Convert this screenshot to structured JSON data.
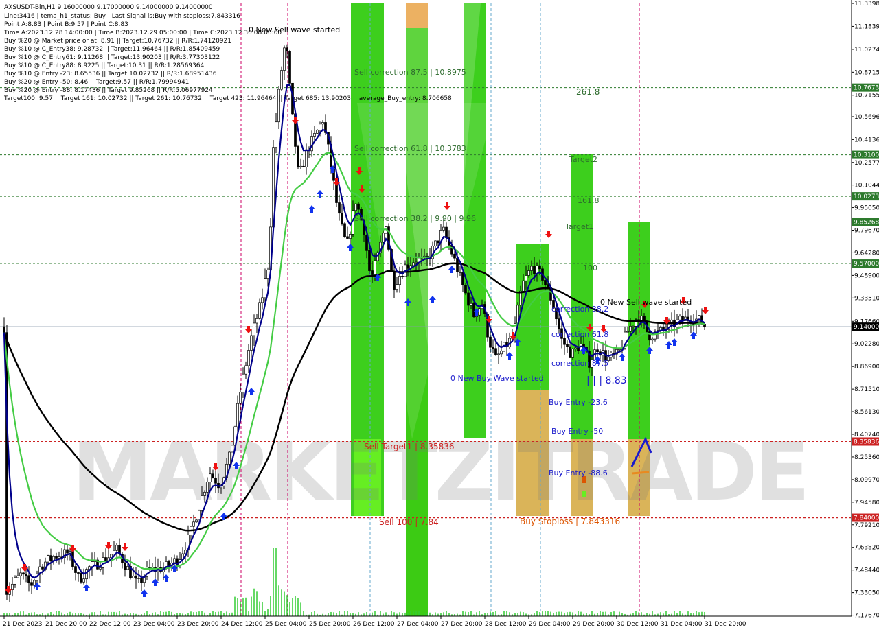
{
  "header": {
    "symbol_line": "AXSUSDT-Bin,H1  9.16000000 9.17000000 9.14000000 9.14000000",
    "info_lines": [
      "Line:3416 | tema_h1_status: Buy | Last Signal is:Buy with stoploss:7.843316",
      "Point A:8.83 | Point B:9.57 | Point C:8.83",
      "Time A:2023.12.28 14:00:00 | Time B:2023.12.29 05:00:00 | Time C:2023.12.30 08:00:00",
      "Buy %20 @ Market price or at: 8.91 || Target:10.76732 || R/R:1.74120921",
      "Buy %10 @ C_Entry38: 9.28732 || Target:11.96464 || R/R:1.85409459",
      "Buy %10 @ C_Entry61: 9.11268 || Target:13.90203 || R/R:3.77303122",
      "Buy %10 @ C_Entry88: 8.9225 || Target:10.31 || R/R:1.28569364",
      "Buy %10 @ Entry -23: 8.65536 || Target:10.02732 || R/R:1.68951436",
      "Buy %20 @ Entry -50: 8.46 || Target:9.57 || R/R:1.79994941",
      "Buy %20 @ Entry -88: 8.17436 || Target:9.85268 || R/R:5.06977924",
      "Target100: 9.57 || Target 161: 10.02732 || Target 261: 10.76732 || Target 423: 11.96464 || Target 685: 13.90203 || average_Buy_entry: 8.706658"
    ]
  },
  "watermark": "MARKETZITRADE",
  "colors": {
    "green_zone": "#33cc11",
    "green_zone_light": "#66ee22",
    "orange_zone": "#e8a040",
    "tan_zone": "#d8b050",
    "grid_green": "#2d7a2d",
    "grid_red": "#cc0000",
    "ema_fast": "#00008b",
    "ema_mid": "#44cc44",
    "ema_slow": "#000000",
    "label_green": "#2d6b2d",
    "label_blue": "#1a1acc",
    "label_red": "#cc2222",
    "label_orange": "#dd5500"
  },
  "chart_data": {
    "type": "candlestick",
    "symbol": "AXSUSDT-Bin",
    "timeframe": "H1",
    "last_price": 9.14,
    "ylim": [
      7.17,
      11.34
    ],
    "y_ticks": [
      "11.33980",
      "11.18390",
      "11.02740",
      "10.87150",
      "10.71550",
      "10.56960",
      "10.41360",
      "10.25770",
      "10.10440",
      "9.95050",
      "9.79670",
      "9.64280",
      "9.48900",
      "9.33510",
      "9.17660",
      "9.02280",
      "8.86900",
      "8.71510",
      "8.56130",
      "8.40740",
      "8.25360",
      "8.09970",
      "7.94580",
      "7.79210",
      "7.63820",
      "7.48440",
      "7.33050",
      "7.17670"
    ],
    "x_ticks": [
      "21 Dec 2023",
      "21 Dec 20:00",
      "22 Dec 12:00",
      "23 Dec 04:00",
      "23 Dec 20:00",
      "24 Dec 12:00",
      "25 Dec 04:00",
      "25 Dec 20:00",
      "26 Dec 12:00",
      "27 Dec 04:00",
      "27 Dec 20:00",
      "28 Dec 12:00",
      "29 Dec 04:00",
      "29 Dec 20:00",
      "30 Dec 12:00",
      "31 Dec 04:00",
      "31 Dec 20:00"
    ],
    "levels": [
      {
        "value": 10.7673,
        "label": "10.7673",
        "color": "#2d7a2d"
      },
      {
        "value": 10.31,
        "label": "10.3100",
        "color": "#2d7a2d"
      },
      {
        "value": 10.0273,
        "label": "10.0273",
        "color": "#2d7a2d"
      },
      {
        "value": 9.8527,
        "label": "9.85268",
        "color": "#2d7a2d"
      },
      {
        "value": 9.57,
        "label": "9.57000",
        "color": "#2d7a2d"
      },
      {
        "value": 8.3584,
        "label": "8.35836",
        "color": "#cc2222"
      },
      {
        "value": 7.84,
        "label": "7.84000",
        "color": "#cc2222"
      }
    ],
    "last_price_label": "9.14000",
    "annotations": [
      {
        "text": "0 New Sell wave started",
        "color": "#000000"
      },
      {
        "text": "Sell correction 87.5 | 10.8975",
        "color": "#2d6b2d"
      },
      {
        "text": "Sell correction 61.8 | 10.3783",
        "color": "#2d6b2d"
      },
      {
        "text": "Sell correction 38.2 | 9.90 | 9.96",
        "color": "#2d6b2d"
      },
      {
        "text": "261.8",
        "color": "#2d6b2d"
      },
      {
        "text": "Target2",
        "color": "#2d6b2d"
      },
      {
        "text": "161.8",
        "color": "#2d6b2d"
      },
      {
        "text": "Target1",
        "color": "#2d6b2d"
      },
      {
        "text": "100",
        "color": "#2d6b2d"
      },
      {
        "text": "0 New Sell wave started",
        "color": "#000000"
      },
      {
        "text": "correction 38.2",
        "color": "#1a1acc"
      },
      {
        "text": "correction 61.8",
        "color": "#1a1acc"
      },
      {
        "text": "correction 87.5",
        "color": "#1a1acc"
      },
      {
        "text": "| | | 8.83",
        "color": "#1a1acc"
      },
      {
        "text": "0 New Buy Wave started",
        "color": "#1a1acc"
      },
      {
        "text": "Buy Entry -23.6",
        "color": "#1a1acc"
      },
      {
        "text": "Buy Entry -50",
        "color": "#1a1acc"
      },
      {
        "text": "Buy Entry -88.6",
        "color": "#1a1acc"
      },
      {
        "text": "Sell Target1 | 8.35836",
        "color": "#cc2222"
      },
      {
        "text": "Sell 100 | 7.84",
        "color": "#cc2222"
      },
      {
        "text": "Buy Stoploss | 7.843316",
        "color": "#dd5500"
      }
    ]
  }
}
